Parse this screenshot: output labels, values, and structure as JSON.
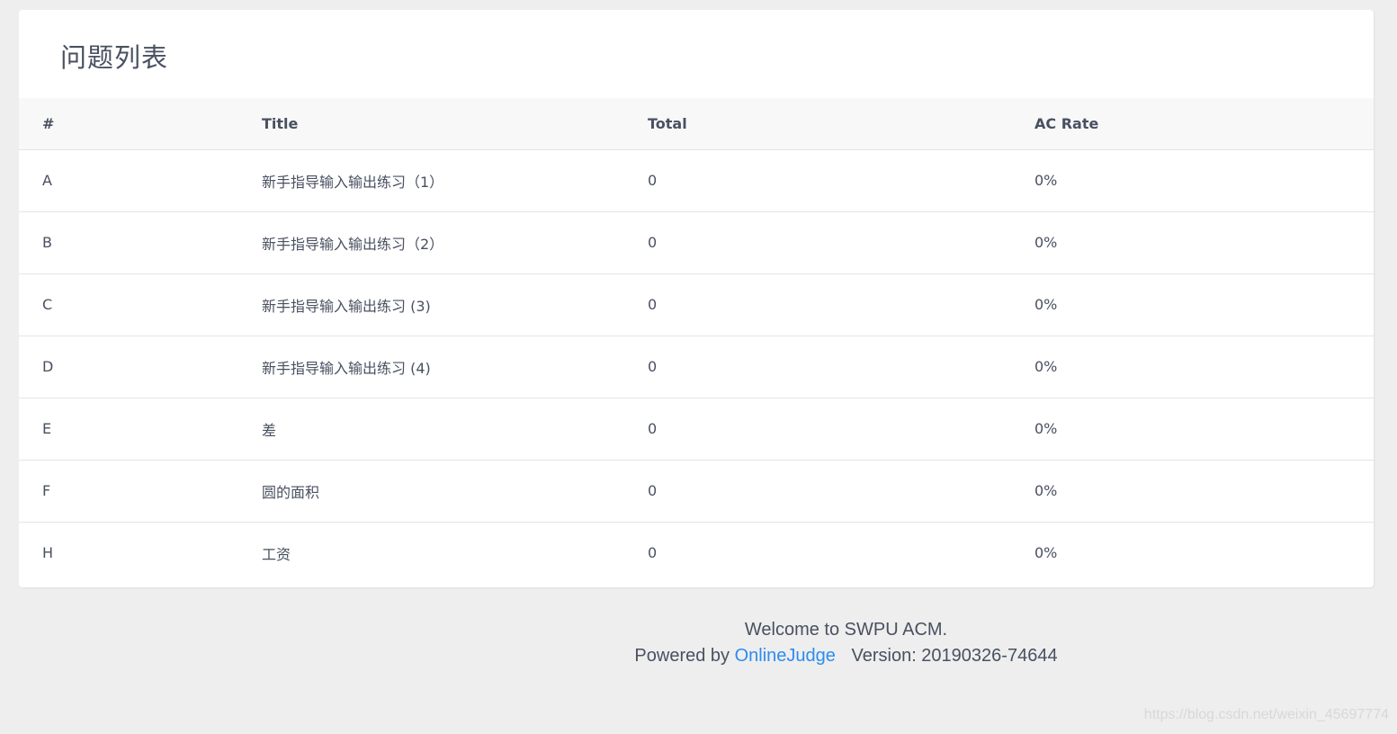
{
  "page": {
    "title": "问题列表"
  },
  "table": {
    "headers": [
      "#",
      "Title",
      "Total",
      "AC Rate"
    ],
    "rows": [
      {
        "id": "A",
        "title": "新手指导输入输出练习（1）",
        "total": "0",
        "ac_rate": "0%"
      },
      {
        "id": "B",
        "title": "新手指导输入输出练习（2）",
        "total": "0",
        "ac_rate": "0%"
      },
      {
        "id": "C",
        "title": "新手指导输入输出练习 (3)",
        "total": "0",
        "ac_rate": "0%"
      },
      {
        "id": "D",
        "title": "新手指导输入输出练习 (4)",
        "total": "0",
        "ac_rate": "0%"
      },
      {
        "id": "E",
        "title": "差",
        "total": "0",
        "ac_rate": "0%"
      },
      {
        "id": "F",
        "title": "圆的面积",
        "total": "0",
        "ac_rate": "0%"
      },
      {
        "id": "H",
        "title": "工资",
        "total": "0",
        "ac_rate": "0%"
      }
    ]
  },
  "footer": {
    "welcome": "Welcome to SWPU ACM.",
    "powered_by": "Powered by",
    "link_text": "OnlineJudge",
    "version": "Version: 20190326-74644"
  },
  "watermark": "https://blog.csdn.net/weixin_45697774",
  "colors": {
    "background": "#eeeeee",
    "card": "#ffffff",
    "header_row": "#f8f8f9",
    "text": "#495060",
    "link": "#2d8cf0"
  }
}
